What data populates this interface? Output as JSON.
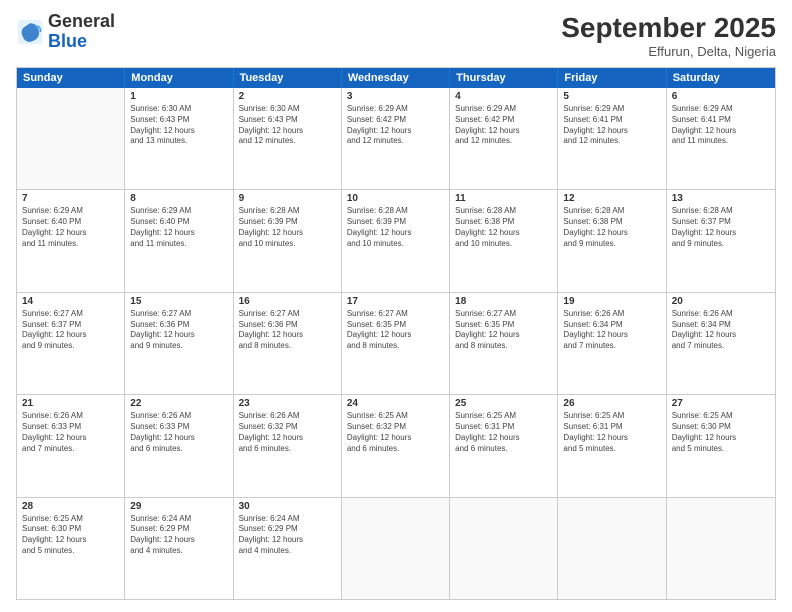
{
  "header": {
    "logo_general": "General",
    "logo_blue": "Blue",
    "month_title": "September 2025",
    "location": "Effurun, Delta, Nigeria"
  },
  "weekdays": [
    "Sunday",
    "Monday",
    "Tuesday",
    "Wednesday",
    "Thursday",
    "Friday",
    "Saturday"
  ],
  "rows": [
    [
      {
        "day": "",
        "info": ""
      },
      {
        "day": "1",
        "info": "Sunrise: 6:30 AM\nSunset: 6:43 PM\nDaylight: 12 hours\nand 13 minutes."
      },
      {
        "day": "2",
        "info": "Sunrise: 6:30 AM\nSunset: 6:43 PM\nDaylight: 12 hours\nand 12 minutes."
      },
      {
        "day": "3",
        "info": "Sunrise: 6:29 AM\nSunset: 6:42 PM\nDaylight: 12 hours\nand 12 minutes."
      },
      {
        "day": "4",
        "info": "Sunrise: 6:29 AM\nSunset: 6:42 PM\nDaylight: 12 hours\nand 12 minutes."
      },
      {
        "day": "5",
        "info": "Sunrise: 6:29 AM\nSunset: 6:41 PM\nDaylight: 12 hours\nand 12 minutes."
      },
      {
        "day": "6",
        "info": "Sunrise: 6:29 AM\nSunset: 6:41 PM\nDaylight: 12 hours\nand 11 minutes."
      }
    ],
    [
      {
        "day": "7",
        "info": "Sunrise: 6:29 AM\nSunset: 6:40 PM\nDaylight: 12 hours\nand 11 minutes."
      },
      {
        "day": "8",
        "info": "Sunrise: 6:29 AM\nSunset: 6:40 PM\nDaylight: 12 hours\nand 11 minutes."
      },
      {
        "day": "9",
        "info": "Sunrise: 6:28 AM\nSunset: 6:39 PM\nDaylight: 12 hours\nand 10 minutes."
      },
      {
        "day": "10",
        "info": "Sunrise: 6:28 AM\nSunset: 6:39 PM\nDaylight: 12 hours\nand 10 minutes."
      },
      {
        "day": "11",
        "info": "Sunrise: 6:28 AM\nSunset: 6:38 PM\nDaylight: 12 hours\nand 10 minutes."
      },
      {
        "day": "12",
        "info": "Sunrise: 6:28 AM\nSunset: 6:38 PM\nDaylight: 12 hours\nand 9 minutes."
      },
      {
        "day": "13",
        "info": "Sunrise: 6:28 AM\nSunset: 6:37 PM\nDaylight: 12 hours\nand 9 minutes."
      }
    ],
    [
      {
        "day": "14",
        "info": "Sunrise: 6:27 AM\nSunset: 6:37 PM\nDaylight: 12 hours\nand 9 minutes."
      },
      {
        "day": "15",
        "info": "Sunrise: 6:27 AM\nSunset: 6:36 PM\nDaylight: 12 hours\nand 9 minutes."
      },
      {
        "day": "16",
        "info": "Sunrise: 6:27 AM\nSunset: 6:36 PM\nDaylight: 12 hours\nand 8 minutes."
      },
      {
        "day": "17",
        "info": "Sunrise: 6:27 AM\nSunset: 6:35 PM\nDaylight: 12 hours\nand 8 minutes."
      },
      {
        "day": "18",
        "info": "Sunrise: 6:27 AM\nSunset: 6:35 PM\nDaylight: 12 hours\nand 8 minutes."
      },
      {
        "day": "19",
        "info": "Sunrise: 6:26 AM\nSunset: 6:34 PM\nDaylight: 12 hours\nand 7 minutes."
      },
      {
        "day": "20",
        "info": "Sunrise: 6:26 AM\nSunset: 6:34 PM\nDaylight: 12 hours\nand 7 minutes."
      }
    ],
    [
      {
        "day": "21",
        "info": "Sunrise: 6:26 AM\nSunset: 6:33 PM\nDaylight: 12 hours\nand 7 minutes."
      },
      {
        "day": "22",
        "info": "Sunrise: 6:26 AM\nSunset: 6:33 PM\nDaylight: 12 hours\nand 6 minutes."
      },
      {
        "day": "23",
        "info": "Sunrise: 6:26 AM\nSunset: 6:32 PM\nDaylight: 12 hours\nand 6 minutes."
      },
      {
        "day": "24",
        "info": "Sunrise: 6:25 AM\nSunset: 6:32 PM\nDaylight: 12 hours\nand 6 minutes."
      },
      {
        "day": "25",
        "info": "Sunrise: 6:25 AM\nSunset: 6:31 PM\nDaylight: 12 hours\nand 6 minutes."
      },
      {
        "day": "26",
        "info": "Sunrise: 6:25 AM\nSunset: 6:31 PM\nDaylight: 12 hours\nand 5 minutes."
      },
      {
        "day": "27",
        "info": "Sunrise: 6:25 AM\nSunset: 6:30 PM\nDaylight: 12 hours\nand 5 minutes."
      }
    ],
    [
      {
        "day": "28",
        "info": "Sunrise: 6:25 AM\nSunset: 6:30 PM\nDaylight: 12 hours\nand 5 minutes."
      },
      {
        "day": "29",
        "info": "Sunrise: 6:24 AM\nSunset: 6:29 PM\nDaylight: 12 hours\nand 4 minutes."
      },
      {
        "day": "30",
        "info": "Sunrise: 6:24 AM\nSunset: 6:29 PM\nDaylight: 12 hours\nand 4 minutes."
      },
      {
        "day": "",
        "info": ""
      },
      {
        "day": "",
        "info": ""
      },
      {
        "day": "",
        "info": ""
      },
      {
        "day": "",
        "info": ""
      }
    ]
  ]
}
